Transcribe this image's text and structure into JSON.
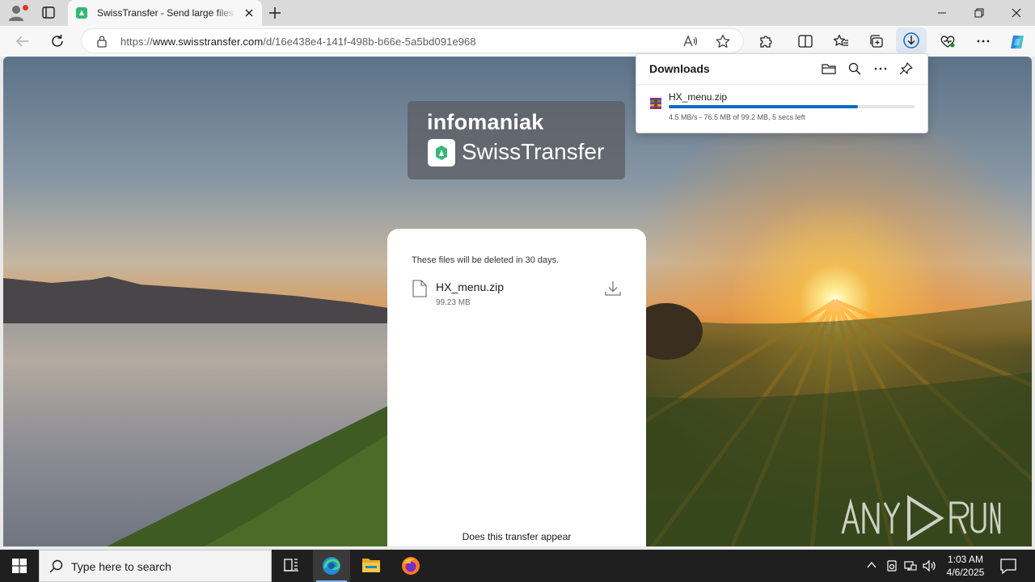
{
  "browser": {
    "tab": {
      "title": "SwissTransfer - Send large files securely"
    },
    "address": {
      "scheme": "https://",
      "host": "www.swisstransfer.com",
      "path": "/d/16e438e4-141f-498b-b66e-5a5bd091e968"
    },
    "toolbar_icons": [
      "back-icon",
      "refresh-icon",
      "lock-icon",
      "read-aloud-icon",
      "favorite-star-icon",
      "extensions-icon",
      "split-screen-icon",
      "favorites-icon",
      "collections-icon",
      "downloads-icon",
      "browser-essentials-icon",
      "more-icon",
      "copilot-icon"
    ]
  },
  "downloads": {
    "title": "Downloads",
    "item": {
      "name": "HX_menu.zip",
      "status": "4.5 MB/s - 76.5 MB of 99.2 MB, 5 secs left",
      "progress": 0.771
    }
  },
  "page": {
    "brand_top": "infomaniak",
    "brand_name": "SwissTransfer",
    "card": {
      "note": "These files will be deleted in 30 days.",
      "file_name": "HX_menu.zip",
      "file_size": "99.23 MB",
      "bottom_text": "Does this transfer appear"
    },
    "watermark": "ANY RUN"
  },
  "taskbar": {
    "search_placeholder": "Type here to search",
    "time": "1:03 AM",
    "date": "4/6/2025"
  },
  "colors": {
    "accent": "#0f6cbd",
    "swisstransfer_green": "#35b876",
    "taskbar": "#1f1f1f"
  }
}
